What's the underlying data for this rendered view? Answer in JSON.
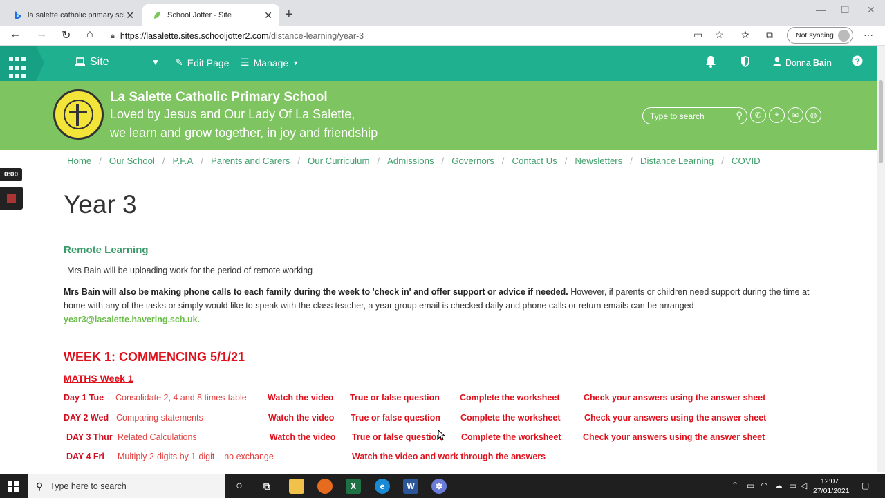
{
  "browser": {
    "tabs": [
      {
        "title": "la salette catholic primary school",
        "favicon": "bing-icon",
        "active": false
      },
      {
        "title": "School Jotter - Site",
        "favicon": "schooljotter-leaf-icon",
        "active": true
      }
    ],
    "url_host": "https://lasalette.sites.schooljotter2.com",
    "url_path": "/distance-learning/year-3",
    "sync_label": "Not syncing"
  },
  "adminbar": {
    "site_label": "Site",
    "edit_label": "Edit Page",
    "manage_label": "Manage",
    "user_first": "Donna",
    "user_last": "Bain"
  },
  "header": {
    "school_name": "La Salette Catholic Primary School",
    "motto_line1": "Loved by Jesus and Our Lady Of La Salette,",
    "motto_line2": "we learn and grow together, in joy and friendship",
    "search_placeholder": "Type to search"
  },
  "nav": {
    "items": [
      "Home",
      "Our School",
      "P.F.A",
      "Parents and Carers",
      "Our Curriculum",
      "Admissions",
      "Governors",
      "Contact Us",
      "Newsletters",
      "Distance Learning",
      "COVID"
    ],
    "separator": "/"
  },
  "recorder": {
    "time": "0:00"
  },
  "content": {
    "title": "Year 3",
    "section_heading": "Remote Learning",
    "intro": "Mrs Bain will be uploading work for the  period of remote working",
    "para_bold": "Mrs Bain will also be making phone calls to each family during the week to 'check in' and offer support or advice if needed.",
    "para_text": " However, if parents or children need support during the time at home with any of the tasks or simply would like to speak with the class teacher, a year group email is checked daily and phone calls or return emails can be arranged ",
    "email": "year3@lasalette.havering.sch.uk.",
    "week_heading": "WEEK 1: COMMENCING 5/1/21",
    "maths_heading": "MATHS Week 1",
    "rows": [
      {
        "day": "Day 1  Tue",
        "topic": "Consolidate 2, 4 and 8 times-table",
        "links": [
          "Watch the video",
          "True or false question",
          "Complete the worksheet",
          "Check your answers using the answer sheet"
        ]
      },
      {
        "day": "DAY 2  Wed",
        "topic": "Comparing statements",
        "links": [
          "Watch the video",
          "True or false question",
          "Complete the worksheet",
          "Check your answers using the answer sheet"
        ]
      },
      {
        "day": "DAY 3 Thur",
        "topic": "Related Calculations",
        "links": [
          "Watch the video",
          "True or false question",
          "Complete the worksheet",
          "Check your answers using the answer sheet"
        ]
      },
      {
        "day": "DAY 4  Fri",
        "topic": "Multiply 2-digits by 1-digit – no exchange",
        "links": [
          "Watch the video and work through the answers"
        ]
      }
    ]
  },
  "taskbar": {
    "search_placeholder": "Type here to search",
    "time": "12:07",
    "date": "27/01/2021"
  },
  "colors": {
    "admin_bar": "#1fb08f",
    "header_green": "#7ec460",
    "nav_link": "#3fa06a",
    "red_heading": "#e0111c"
  }
}
